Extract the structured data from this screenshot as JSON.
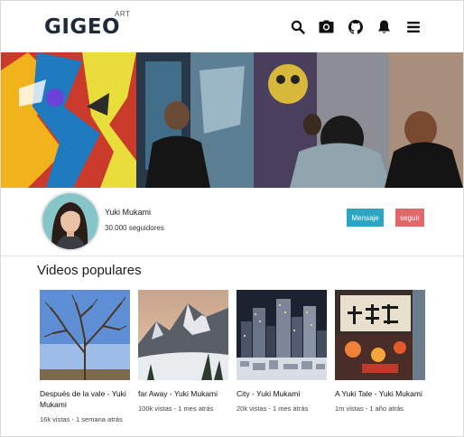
{
  "header": {
    "logo_text": "GIGEO",
    "logo_sup": "ART",
    "icons": [
      "search-icon",
      "camera-icon",
      "github-icon",
      "bell-icon",
      "menu-icon"
    ]
  },
  "profile": {
    "name": "Yuki Mukami",
    "subscribers": "30.000 seguidores",
    "message_label": "Mensaje",
    "follow_label": "seguir"
  },
  "colors": {
    "logo": "#1e2a38",
    "message_button": "#2ba6c2",
    "follow_button": "#e0676a"
  },
  "section": {
    "title": "Videos populares"
  },
  "videos": [
    {
      "title": "Después de la vale - Yuki Mukami",
      "meta": "16k vistas - 1 semana atrás"
    },
    {
      "title": "far Away - Yuki Mukami",
      "meta": "100k vistas - 1 mes atrás"
    },
    {
      "title": "City - Yuki Mukami",
      "meta": "20k vistas - 1 mes atrás"
    },
    {
      "title": "A Yuki Tale - Yuki Mukami",
      "meta": "1m vistas - 1 año atrás"
    }
  ]
}
